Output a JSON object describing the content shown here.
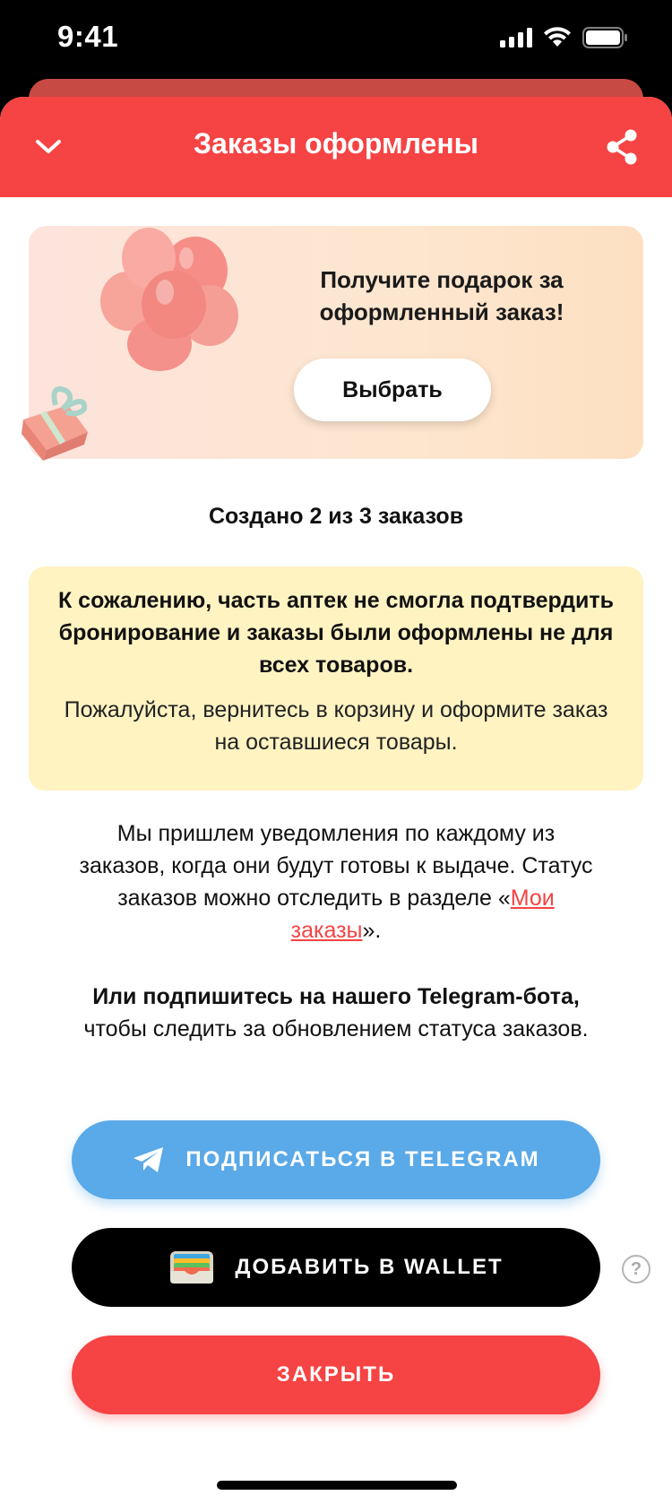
{
  "status_bar": {
    "time": "9:41"
  },
  "header": {
    "title": "Заказы оформлены"
  },
  "promo": {
    "text": "Получите подарок за оформленный заказ!",
    "button": "Выбрать"
  },
  "orders_count": "Создано 2 из 3 заказов",
  "warning": {
    "bold": "К сожалению, часть аптек не смогла подтвердить бронирование и заказы были оформлены не для всех товаров.",
    "regular": "Пожалуйста, вернитесь в корзину и оформите заказ на оставшиеся товары."
  },
  "info": {
    "before_link": "Мы пришлем уведомления по каждому из заказов, когда они будут готовы к выдаче. Статус заказов можно отследить в разделе «",
    "link": "Мои заказы",
    "after_link": "»."
  },
  "telegram_info": {
    "bold": "Или подпишитесь на нашего Telegram-бота,",
    "regular": " чтобы следить за обновлением статуса заказов."
  },
  "buttons": {
    "telegram": "ПОДПИСАТЬСЯ В TELEGRAM",
    "wallet": "ДОБАВИТЬ В WALLET",
    "close": "ЗАКРЫТЬ",
    "help": "?"
  },
  "colors": {
    "accent": "#f64343",
    "telegram": "#5aa9e8",
    "warning_bg": "#fff3c2"
  },
  "icons": [
    "chevron-down-icon",
    "share-icon",
    "telegram-icon",
    "wallet-icon",
    "help-icon"
  ]
}
